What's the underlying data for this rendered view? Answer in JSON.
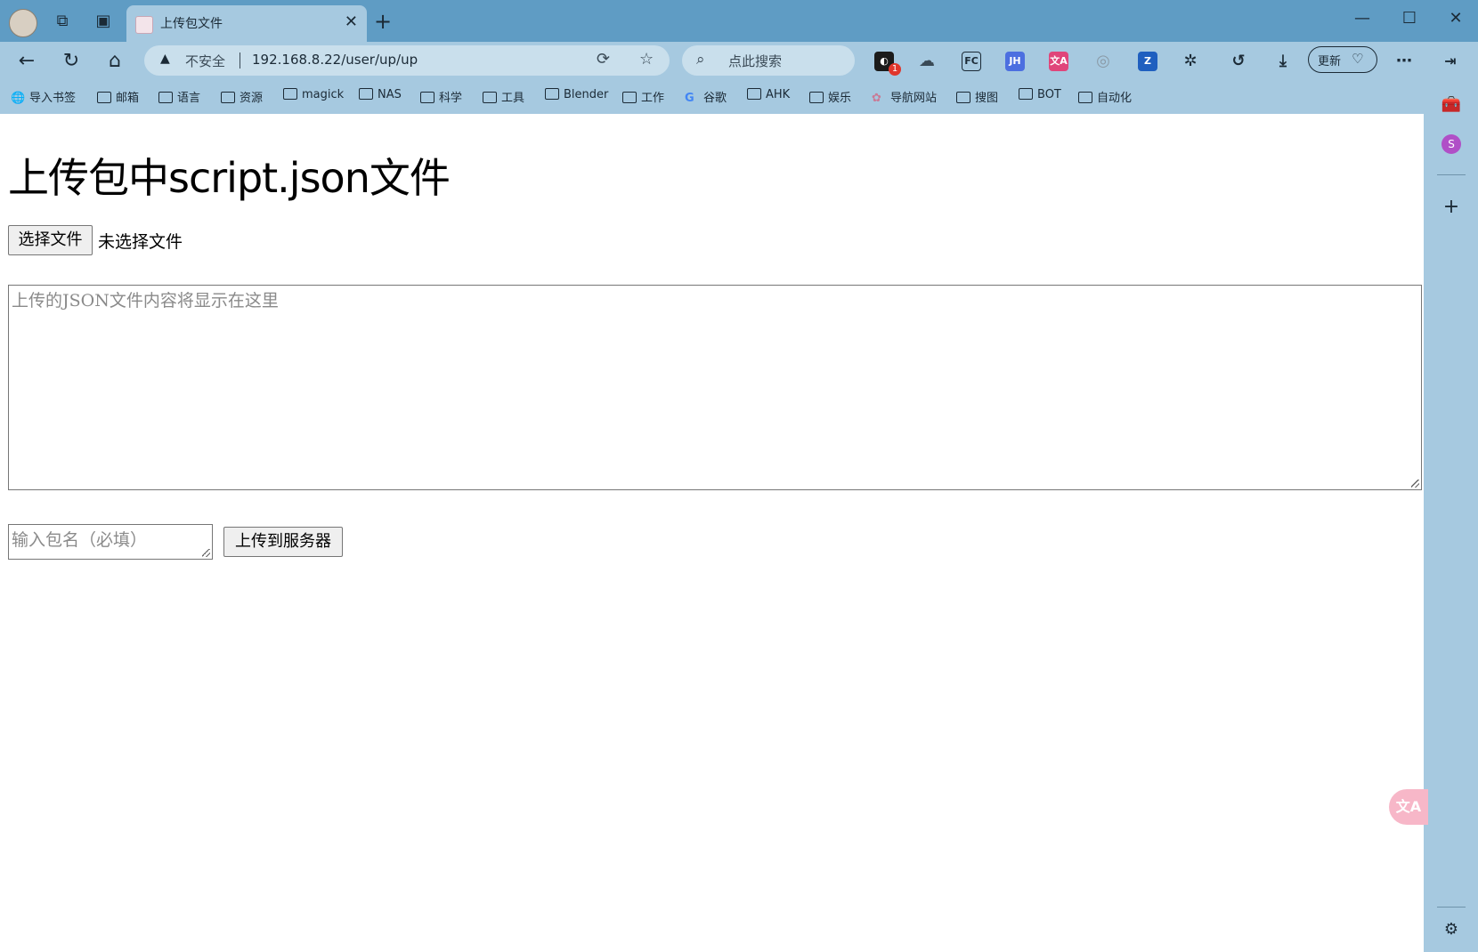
{
  "browser": {
    "tab_title": "上传包文件",
    "address": {
      "security_label": "不安全",
      "url": "192.168.8.22/user/up/up"
    },
    "search_placeholder": "点此搜索",
    "update_label": "更新",
    "extension_badge": "1"
  },
  "bookmarks": [
    {
      "label": "导入书签",
      "icon": "globe-icon"
    },
    {
      "label": "邮箱",
      "icon": "folder-icon"
    },
    {
      "label": "语言",
      "icon": "folder-icon"
    },
    {
      "label": "资源",
      "icon": "folder-icon"
    },
    {
      "label": "magick",
      "icon": "folder-icon"
    },
    {
      "label": "NAS",
      "icon": "folder-icon"
    },
    {
      "label": "科学",
      "icon": "folder-icon"
    },
    {
      "label": "工具",
      "icon": "folder-icon"
    },
    {
      "label": "Blender",
      "icon": "folder-icon"
    },
    {
      "label": "工作",
      "icon": "folder-icon"
    },
    {
      "label": "谷歌",
      "icon": "google-icon"
    },
    {
      "label": "AHK",
      "icon": "folder-icon"
    },
    {
      "label": "娱乐",
      "icon": "folder-icon"
    },
    {
      "label": "导航网站",
      "icon": "site-icon"
    },
    {
      "label": "搜图",
      "icon": "folder-icon"
    },
    {
      "label": "BOT",
      "icon": "folder-icon"
    },
    {
      "label": "自动化",
      "icon": "folder-icon"
    }
  ],
  "page": {
    "heading": "上传包中script.json文件",
    "choose_file_label": "选择文件",
    "no_file_text": "未选择文件",
    "json_placeholder": "上传的JSON文件内容将显示在这里",
    "package_name_placeholder": "输入包名（必填）",
    "upload_button_label": "上传到服务器"
  },
  "colors": {
    "titlebar": "#5f9cc4",
    "toolbar": "#a6c9e0",
    "sidebar": "#a6c9e0"
  }
}
